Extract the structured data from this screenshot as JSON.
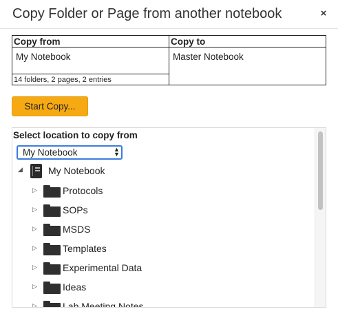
{
  "dialog": {
    "title": "Copy Folder or Page from another notebook",
    "close_label": "×"
  },
  "copy_table": {
    "from_header": "Copy from",
    "from_value": "My Notebook",
    "from_summary": "14 folders, 2 pages, 2 entries",
    "to_header": "Copy to",
    "to_value": "Master Notebook"
  },
  "start_button": {
    "label": "Start Copy..."
  },
  "location": {
    "label": "Select location to copy from",
    "selected": "My Notebook"
  },
  "tree": {
    "root": {
      "label": "My Notebook",
      "icon": "notebook-icon",
      "toggle": "◢"
    },
    "folders": [
      {
        "label": "Protocols",
        "icon": "folder-icon",
        "toggle": "▷"
      },
      {
        "label": "SOPs",
        "icon": "folder-icon",
        "toggle": "▷"
      },
      {
        "label": "MSDS",
        "icon": "folder-icon",
        "toggle": "▷"
      },
      {
        "label": "Templates",
        "icon": "folder-icon",
        "toggle": "▷"
      },
      {
        "label": "Experimental Data",
        "icon": "folder-icon",
        "toggle": "▷"
      },
      {
        "label": "Ideas",
        "icon": "folder-icon",
        "toggle": "▷"
      },
      {
        "label": "Lab Meeting Notes",
        "icon": "folder-icon",
        "toggle": "▷"
      }
    ]
  },
  "colors": {
    "button": "#f7a913",
    "select_border": "#3b7ddb"
  }
}
